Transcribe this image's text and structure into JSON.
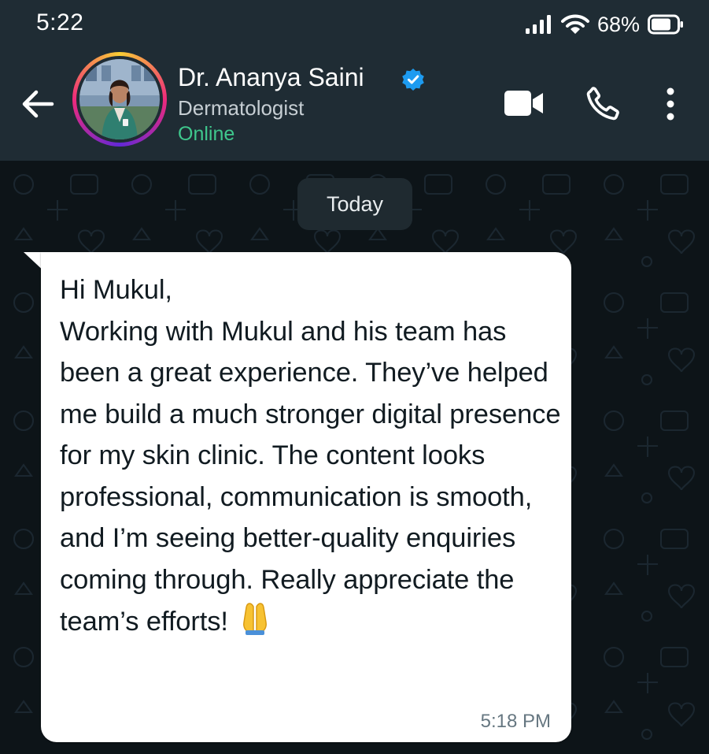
{
  "status_bar": {
    "time": "5:22",
    "battery_percent": "68%",
    "icons": [
      "signal-icon",
      "wifi-icon",
      "battery-icon"
    ]
  },
  "header": {
    "contact_name": "Dr. Ananya Saini",
    "contact_subtitle": "Dermatologist",
    "contact_status": "Online",
    "verified": true,
    "icons": [
      "back-arrow-icon",
      "video-call-icon",
      "voice-call-icon",
      "more-options-icon"
    ]
  },
  "chat": {
    "date_label": "Today",
    "messages": [
      {
        "text": "Hi Mukul,\nWorking with Mukul and his team has been a great experience. They’ve helped me build a much stronger digital presence for my skin clinic. The content looks professional, communication is smooth, and I’m seeing better-quality enquiries coming through. Really appreciate the team’s efforts!",
        "emoji": "folded-hands",
        "time": "5:18 PM"
      }
    ]
  },
  "colors": {
    "header_bg": "#1f2c34",
    "chat_bg": "#0d1418",
    "bubble_bg": "#ffffff",
    "online_green": "#3fc88d",
    "verified_blue": "#1d9bf0",
    "date_chip_bg": "#1f2a30"
  }
}
